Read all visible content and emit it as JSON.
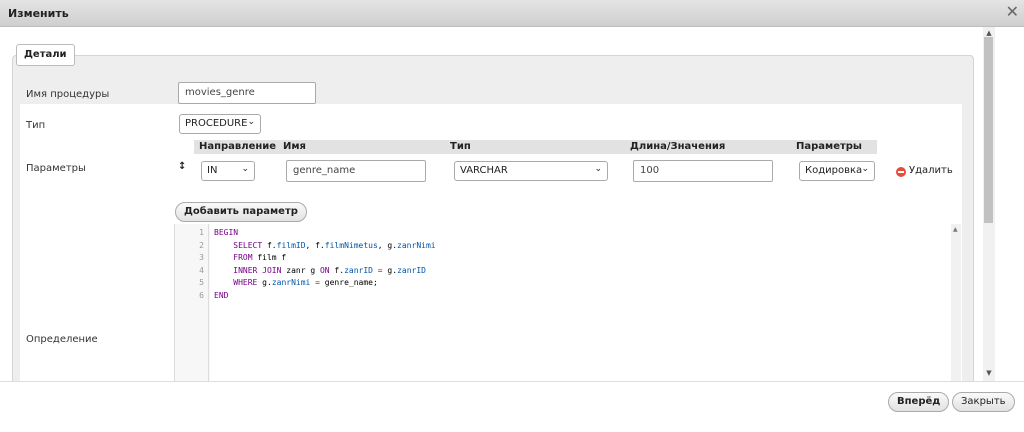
{
  "dialog": {
    "title": "Изменить",
    "close_icon": "close-icon"
  },
  "tab": {
    "label": "Детали"
  },
  "form": {
    "name_label": "Имя процедуры",
    "name_value": "movies_genre",
    "type_label": "Тип",
    "type_value": "PROCEDURE",
    "params_label": "Параметры",
    "definition_label": "Определение"
  },
  "params_table": {
    "headers": {
      "direction": "Направление",
      "name": "Имя",
      "type": "Тип",
      "length": "Длина/Значения",
      "options": "Параметры"
    },
    "row": {
      "direction": "IN",
      "name": "genre_name",
      "type": "VARCHAR",
      "length": "100",
      "options": "Кодировка",
      "delete_label": "Удалить"
    },
    "add_button": "Добавить параметр"
  },
  "editor": {
    "line_numbers": [
      "1",
      "2",
      "3",
      "4",
      "5",
      "6"
    ],
    "lines": [
      [
        {
          "t": "BEGIN",
          "c": "kw"
        }
      ],
      [
        {
          "t": "    ",
          "c": "plain"
        },
        {
          "t": "SELECT",
          "c": "kw"
        },
        {
          "t": " f.",
          "c": "plain"
        },
        {
          "t": "filmID",
          "c": "var"
        },
        {
          "t": ", f.",
          "c": "plain"
        },
        {
          "t": "filmNimetus",
          "c": "var"
        },
        {
          "t": ", g.",
          "c": "plain"
        },
        {
          "t": "zanrNimi",
          "c": "var"
        }
      ],
      [
        {
          "t": "    ",
          "c": "plain"
        },
        {
          "t": "FROM",
          "c": "kw"
        },
        {
          "t": " film f",
          "c": "plain"
        }
      ],
      [
        {
          "t": "    ",
          "c": "plain"
        },
        {
          "t": "INNER JOIN",
          "c": "kw"
        },
        {
          "t": " zanr g ",
          "c": "plain"
        },
        {
          "t": "ON",
          "c": "kw"
        },
        {
          "t": " f.",
          "c": "plain"
        },
        {
          "t": "zanrID",
          "c": "var"
        },
        {
          "t": " = ",
          "c": "op"
        },
        {
          "t": "g.",
          "c": "plain"
        },
        {
          "t": "zanrID",
          "c": "var"
        }
      ],
      [
        {
          "t": "    ",
          "c": "plain"
        },
        {
          "t": "WHERE",
          "c": "kw"
        },
        {
          "t": " g.",
          "c": "plain"
        },
        {
          "t": "zanrNimi",
          "c": "var"
        },
        {
          "t": " = ",
          "c": "op"
        },
        {
          "t": "genre_name;",
          "c": "plain"
        }
      ],
      [
        {
          "t": "END",
          "c": "kw"
        }
      ]
    ]
  },
  "footer": {
    "next_button": "Вперёд",
    "close_button": "Закрыть"
  }
}
